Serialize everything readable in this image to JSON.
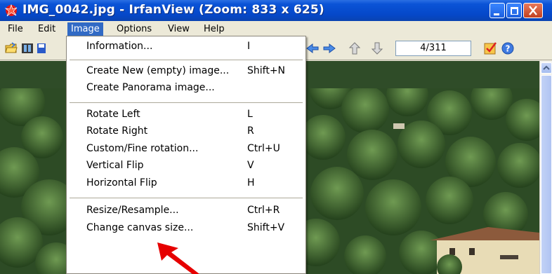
{
  "window": {
    "title": "IMG_0042.jpg - IrfanView (Zoom: 833 x 625)"
  },
  "menubar": {
    "items": [
      {
        "label": "File"
      },
      {
        "label": "Edit"
      },
      {
        "label": "Image"
      },
      {
        "label": "Options"
      },
      {
        "label": "View"
      },
      {
        "label": "Help"
      }
    ],
    "active": "Image"
  },
  "toolbar": {
    "page_counter": "4/311",
    "icons": [
      "open-folder-icon",
      "filmstrip-icon",
      "save-icon",
      "previous-icon",
      "next-icon",
      "page-up-icon",
      "page-down-icon",
      "checkbox-icon",
      "help-icon"
    ]
  },
  "image_menu": {
    "items": [
      {
        "label": "Information...",
        "shortcut": "I"
      },
      {
        "label": "Create New (empty) image...",
        "shortcut": "Shift+N"
      },
      {
        "label": "Create Panorama image...",
        "shortcut": ""
      },
      {
        "label": "Rotate Left",
        "shortcut": "L"
      },
      {
        "label": "Rotate Right",
        "shortcut": "R"
      },
      {
        "label": "Custom/Fine rotation...",
        "shortcut": "Ctrl+U"
      },
      {
        "label": "Vertical Flip",
        "shortcut": "V"
      },
      {
        "label": "Horizontal Flip",
        "shortcut": "H"
      },
      {
        "label": "Resize/Resample...",
        "shortcut": "Ctrl+R"
      },
      {
        "label": "Change canvas size...",
        "shortcut": "Shift+V"
      }
    ]
  },
  "colors": {
    "titlebar": "#0548c9",
    "menu_highlight": "#316ac5",
    "arrow": "#e60000"
  }
}
